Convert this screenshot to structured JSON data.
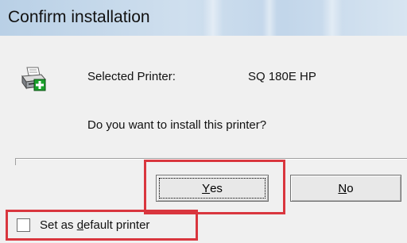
{
  "window": {
    "title": "Confirm installation"
  },
  "printer": {
    "icon": "printer-add-icon",
    "label": "Selected Printer:",
    "value": "SQ 180E HP"
  },
  "question": "Do you want to install this printer?",
  "buttons": {
    "yes": {
      "mnemonic": "Y",
      "rest": "es"
    },
    "no": {
      "mnemonic": "N",
      "rest": "o"
    }
  },
  "default_checkbox": {
    "checked": false,
    "prefix": "Set as ",
    "mnemonic": "d",
    "rest": "efault printer"
  },
  "colors": {
    "highlight": "#d9363e",
    "dialog_bg": "#f0f0f0",
    "titlebar": "#c8dbee"
  }
}
